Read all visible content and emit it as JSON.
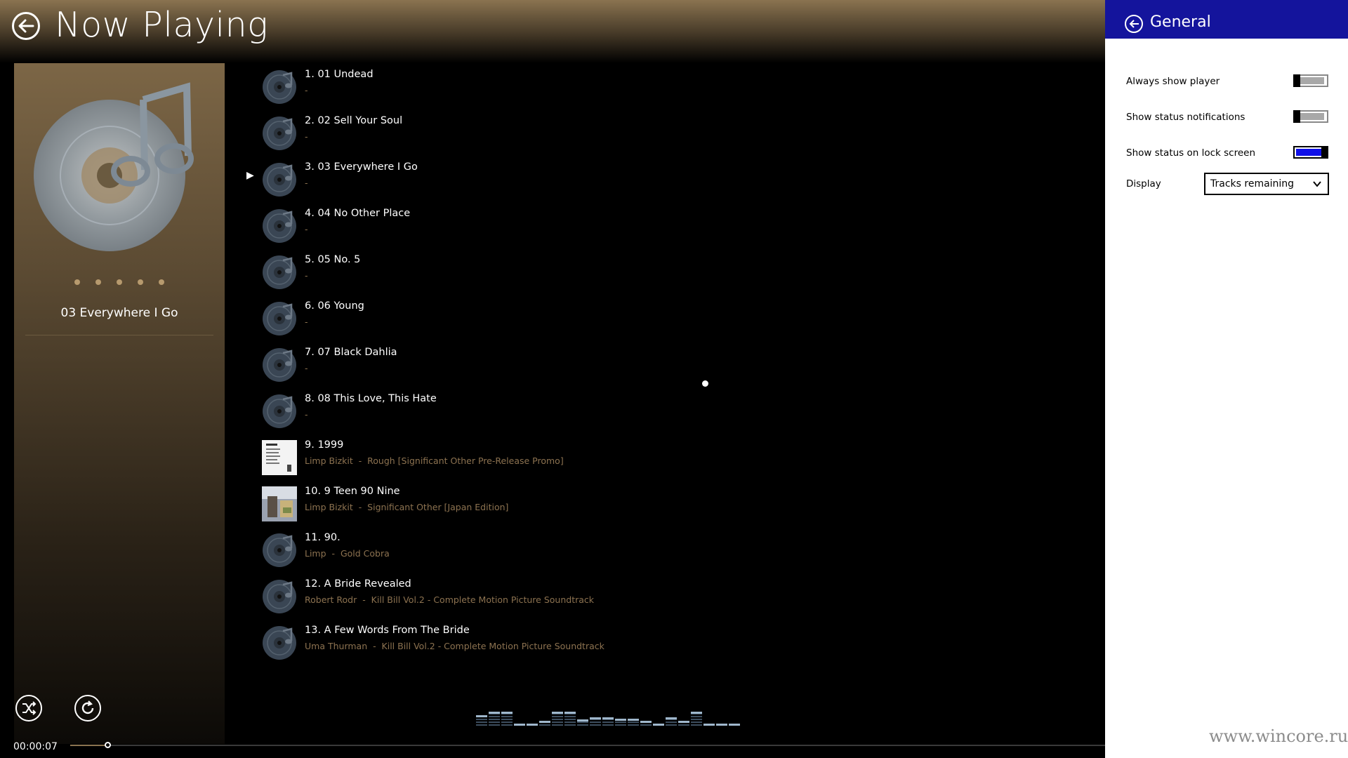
{
  "header": {
    "title": "Now Playing"
  },
  "now_playing": {
    "title": "03 Everywhere I Go",
    "elapsed": "00:00:07",
    "progress_fraction": 0.036
  },
  "playlist": [
    {
      "title": "1. 01 Undead",
      "artist": "-",
      "album": "",
      "thumb": "disc",
      "current": false
    },
    {
      "title": "2. 02 Sell Your Soul",
      "artist": "-",
      "album": "",
      "thumb": "disc",
      "current": false
    },
    {
      "title": "3. 03 Everywhere I Go",
      "artist": "-",
      "album": "",
      "thumb": "disc",
      "current": true
    },
    {
      "title": "4. 04 No Other Place",
      "artist": "-",
      "album": "",
      "thumb": "disc",
      "current": false
    },
    {
      "title": "5. 05 No. 5",
      "artist": "-",
      "album": "",
      "thumb": "disc",
      "current": false
    },
    {
      "title": "6. 06 Young",
      "artist": "-",
      "album": "",
      "thumb": "disc",
      "current": false
    },
    {
      "title": "7. 07 Black Dahlia",
      "artist": "-",
      "album": "",
      "thumb": "disc",
      "current": false
    },
    {
      "title": "8. 08 This Love, This Hate",
      "artist": "-",
      "album": "",
      "thumb": "disc",
      "current": false
    },
    {
      "title": "9. 1999",
      "artist": "Limp Bizkit",
      "album": "Rough [Significant Other Pre-Release Promo]",
      "thumb": "white-cover",
      "current": false
    },
    {
      "title": "10. 9 Teen 90 Nine",
      "artist": "Limp Bizkit",
      "album": "Significant Other [Japan Edition]",
      "thumb": "photo-cover",
      "current": false
    },
    {
      "title": "11. 90.",
      "artist": "Limp",
      "album": "Gold Cobra",
      "thumb": "disc",
      "current": false
    },
    {
      "title": "12. A Bride Revealed",
      "artist": "Robert Rodr",
      "album": "Kill Bill Vol.2 - Complete Motion Picture Soundtrack",
      "thumb": "disc",
      "current": false
    },
    {
      "title": "13. A Few Words From The Bride",
      "artist": "Uma Thurman",
      "album": "Kill Bill Vol.2 - Complete Motion Picture Soundtrack",
      "thumb": "disc",
      "current": false
    }
  ],
  "equalizer_levels": [
    0.45,
    0.6,
    0.6,
    0.1,
    0.1,
    0.2,
    0.6,
    0.6,
    0.25,
    0.35,
    0.35,
    0.3,
    0.3,
    0.2,
    0.1,
    0.35,
    0.2,
    0.6,
    0.1,
    0.1,
    0.1
  ],
  "settings": {
    "title": "General",
    "always_show_player": {
      "label": "Always show player",
      "on": false
    },
    "show_status_notifications": {
      "label": "Show status notifications",
      "on": false
    },
    "show_status_lock_screen": {
      "label": "Show status on lock screen",
      "on": true
    },
    "display": {
      "label": "Display",
      "value": "Tracks remaining"
    }
  },
  "watermark": "www.wincore.ru",
  "colors": {
    "accent_blue": "#14149c",
    "toggle_on": "#1010e8",
    "subtitle_brown": "#8c7250"
  }
}
